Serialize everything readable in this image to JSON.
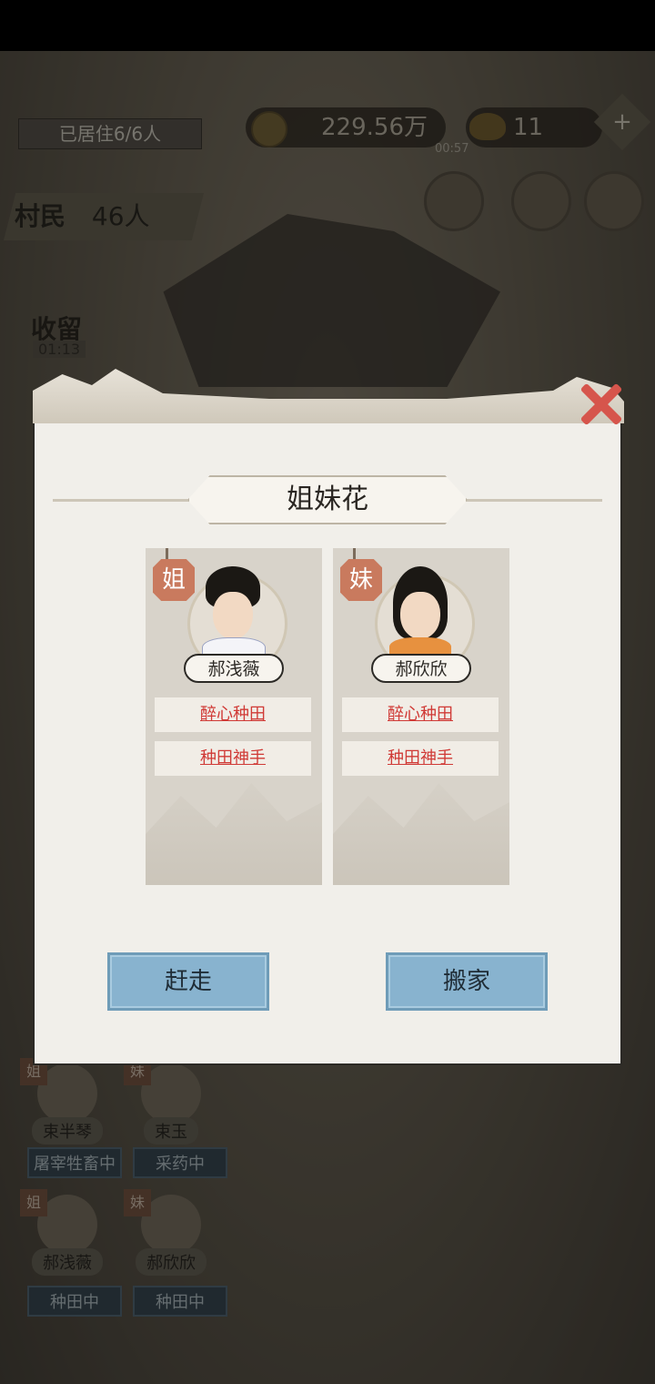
{
  "hud": {
    "residents": "已居住6/6人",
    "coins": "229.56万",
    "timer": "00:57",
    "ingots": "11",
    "plus_icon": "+"
  },
  "sidebar": {
    "villager_label": "村民",
    "villager_count": "46人",
    "shelter_label": "收留",
    "shelter_time": "01:13"
  },
  "popup": {
    "title": "姐妹花",
    "cards": [
      {
        "tag": "姐",
        "name": "郝浅薇",
        "traits": [
          "醉心种田",
          "种田神手"
        ],
        "robe_color": "#ffffff"
      },
      {
        "tag": "妹",
        "name": "郝欣欣",
        "traits": [
          "醉心种田",
          "种田神手"
        ],
        "robe_color": "#e7913f"
      }
    ],
    "buttons": {
      "expel": "赶走",
      "move": "搬家"
    }
  },
  "roster": [
    {
      "badge": "姐",
      "name": "束半琴",
      "status": "屠宰牲畜中"
    },
    {
      "badge": "妹",
      "name": "束玉",
      "status": "采药中"
    },
    {
      "badge": "姐",
      "name": "郝浅薇",
      "status": "种田中"
    },
    {
      "badge": "妹",
      "name": "郝欣欣",
      "status": "种田中"
    }
  ],
  "colors": {
    "close": "#d6554c",
    "button": "#88b3cf",
    "trait_text": "#d03a36"
  }
}
